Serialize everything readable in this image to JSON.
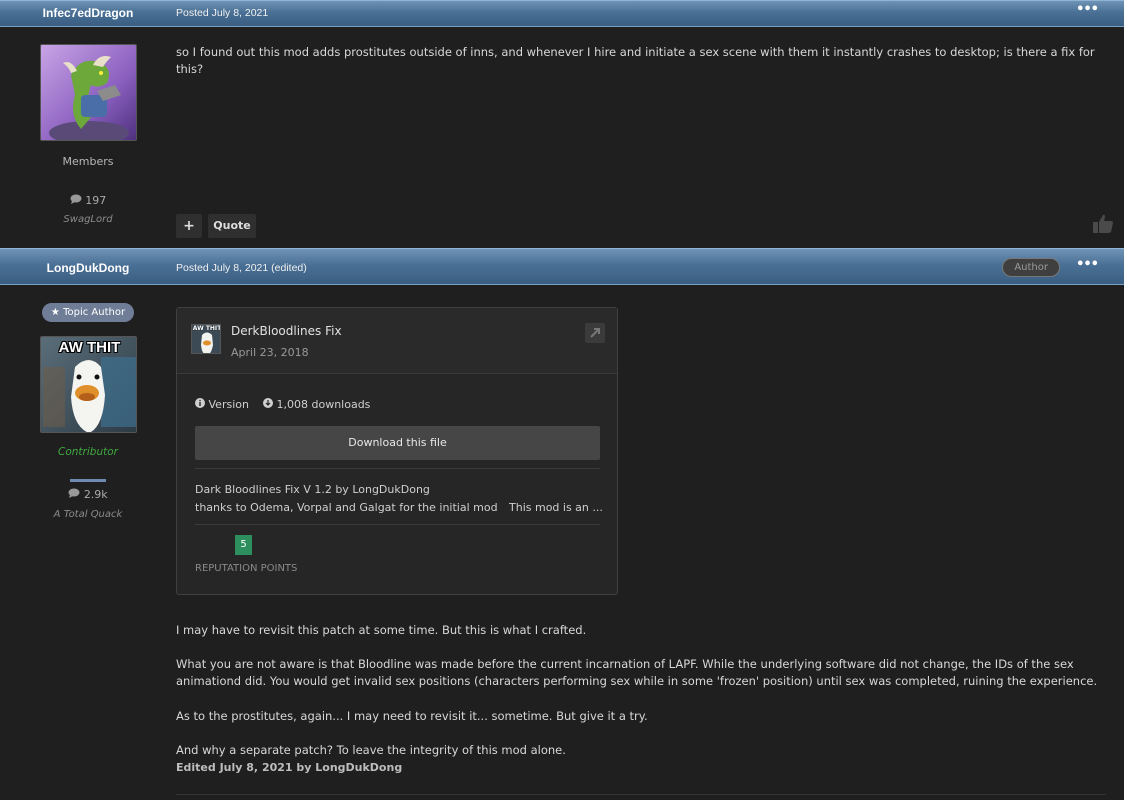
{
  "post1": {
    "author": "Infec7edDragon",
    "posted": "Posted July 8, 2021",
    "more": "•••",
    "group": "Members",
    "post_count": "197",
    "user_title": "SwagLord",
    "body": "so I found out this mod adds prostitutes outside of inns, and whenever I hire and initiate a sex scene with them it instantly crashes to desktop; is there a fix for this?",
    "plus_label": "+",
    "quote_label": "Quote"
  },
  "post2": {
    "author": "LongDukDong",
    "posted": "Posted July 8, 2021 (edited)",
    "author_badge": "Author",
    "more": "•••",
    "topic_author": "Topic Author",
    "avatar_caption": "AW THIT",
    "group": "Contributor",
    "post_count": "2.9k",
    "user_title": "A Total Quack",
    "file_card": {
      "thumb_caption": "AW THIT",
      "title": "DerkBloodlines Fix",
      "date": "April 23, 2018",
      "version_label": "Version",
      "downloads": "1,008 downloads",
      "download_button": "Download this file",
      "desc_line1": "Dark Bloodlines Fix V 1.2  by LongDukDong",
      "desc_line2": "thanks to Odema, Vorpal and Galgat for the initial mod",
      "desc_trunc": "This mod is an ...",
      "reputation": "5",
      "reputation_label": "REPUTATION POINTS"
    },
    "paragraphs": [
      "I may have to revisit this patch at some time.  But this is what I crafted.",
      "What you are not aware is that Bloodline was made before the current incarnation of LAPF.  While the underlying software did not change, the IDs of the sex animationd did.  You would get invalid sex positions (characters performing sex while in some 'frozen' position) until sex was completed, ruining the experience.",
      "As to the prostitutes, again... I may need to revisit it... sometime.  But give it a try.",
      "And why a separate patch?  To leave the integrity of this mod alone."
    ],
    "edited_note": "Edited July 8, 2021 by LongDukDong"
  },
  "colors": {
    "header_blue": "#4a7095",
    "rep_green": "#2e8f5e",
    "contributor_green": "#3fa83f",
    "pill_blue": "#6f7e96"
  }
}
